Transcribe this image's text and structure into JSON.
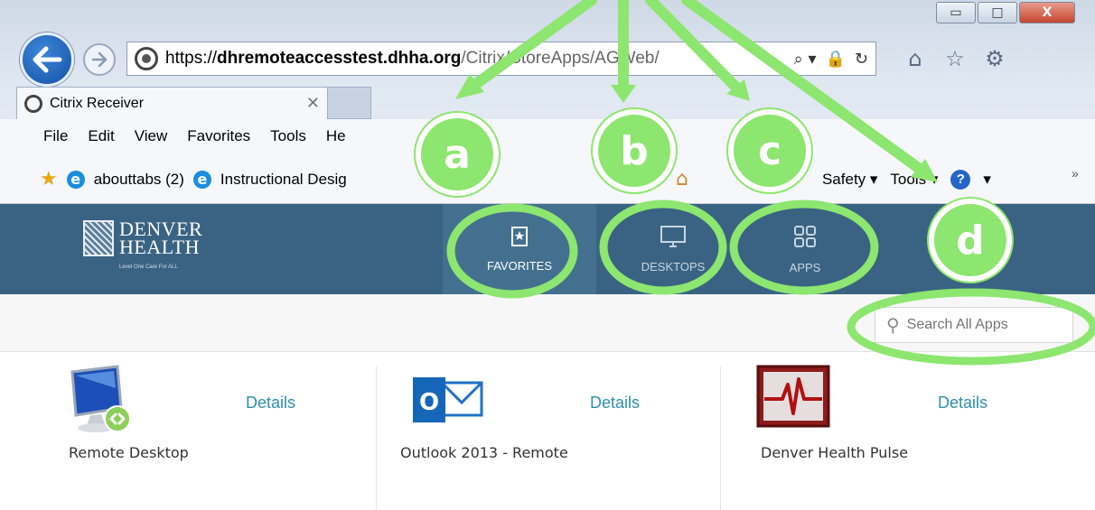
{
  "window": {
    "minimize_glyph": "▭",
    "maximize_glyph": "□",
    "close_glyph": "X"
  },
  "address_bar": {
    "protocol": "https://",
    "host": "dhremoteaccesstest.dhha.org",
    "path": "/Citrix/StoreApps/AGWeb/",
    "search_glyph": "⌕ ▾",
    "lock_glyph": "🔒",
    "refresh_glyph": "↻"
  },
  "tab": {
    "title": "Citrix Receiver",
    "close_glyph": "✕"
  },
  "menu": {
    "items": [
      "File",
      "Edit",
      "View",
      "Favorites",
      "Tools",
      "He"
    ]
  },
  "favorites_bar": {
    "items": [
      {
        "label": "abouttabs (2)"
      },
      {
        "label": "Instructional Desig"
      }
    ],
    "commands": [
      "Safety ▾",
      "Tools ▾"
    ]
  },
  "citrix": {
    "logo_line1": "DENVER",
    "logo_line2": "HEALTH",
    "logo_tagline": "Level One Care For ALL",
    "nav": {
      "favorites": "FAVORITES",
      "desktops": "DESKTOPS",
      "apps": "APPS"
    },
    "search": {
      "placeholder": "Search All Apps"
    },
    "apps": [
      {
        "name": "Remote Desktop",
        "details": "Details"
      },
      {
        "name": "Outlook 2013 - Remote",
        "details": "Details"
      },
      {
        "name": "Denver Health Pulse",
        "details": "Details"
      }
    ]
  },
  "annotations": {
    "labels": [
      "a",
      "b",
      "c",
      "d"
    ],
    "color": "#8de66f"
  },
  "colors": {
    "header_bg": "#3a6383",
    "active_tab_bg": "#44708f",
    "details_link": "#2d8fb0"
  }
}
